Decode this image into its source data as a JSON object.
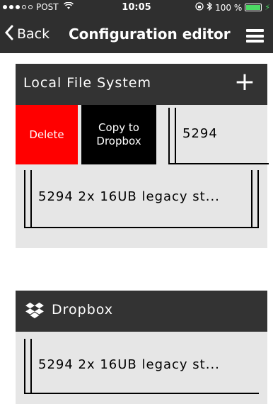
{
  "statusbar": {
    "carrier": "POST",
    "time": "10:05",
    "battery": "100 %",
    "battery_level": 1.0,
    "signal_bars": 3
  },
  "navbar": {
    "back_label": "Back",
    "title": "Configuration editor"
  },
  "local_section": {
    "title": "Local File System",
    "add_label": "+"
  },
  "swipe_actions": {
    "delete_label": "Delete",
    "copy_label_line1": "Copy to",
    "copy_label_line2": "Dropbox"
  },
  "local_files": [
    {
      "name": "5294"
    },
    {
      "name": "5294 2x 16UB legacy st..."
    }
  ],
  "dropbox_section": {
    "title": "Dropbox"
  },
  "dropbox_files": [
    {
      "name": "5294 2x 16UB legacy st..."
    }
  ],
  "colors": {
    "bar_bg": "#2f2f2f",
    "panel_bg": "#e6e6e6",
    "header_bg": "#333333",
    "delete": "#ff0000",
    "copy": "#000000",
    "battery": "#4cd964"
  }
}
